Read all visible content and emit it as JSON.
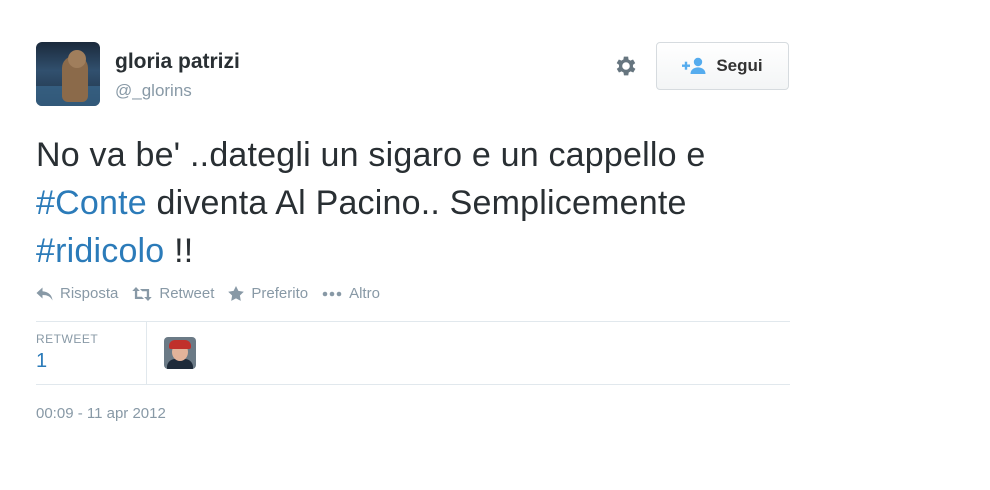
{
  "user": {
    "name": "gloria patrizi",
    "handle": "@_glorins",
    "avatar_icon": "profile-photo"
  },
  "follow_button": {
    "label": "Segui",
    "icon": "add-user-icon"
  },
  "settings_icon": "gear-icon",
  "tweet": {
    "text_part1": "No va be' ..dategli un sigaro e un cappello e ",
    "hashtag1": "#Conte",
    "text_part2": " diventa Al Pacino.. Semplicemente ",
    "hashtag2": "#ridicolo",
    "text_part3": " !!"
  },
  "actions": [
    {
      "label": "Risposta",
      "icon": "reply-icon"
    },
    {
      "label": "Retweet",
      "icon": "retweet-icon"
    },
    {
      "label": "Preferito",
      "icon": "star-icon"
    },
    {
      "label": "Altro",
      "icon": "more-dots-icon"
    }
  ],
  "stats": {
    "label": "RETWEET",
    "count": "1"
  },
  "timestamp": "00:09 - 11 apr 2012",
  "colors": {
    "link": "#2b7bb9",
    "muted": "#8899a6",
    "text": "#292f33",
    "border": "#e1e8ed"
  }
}
